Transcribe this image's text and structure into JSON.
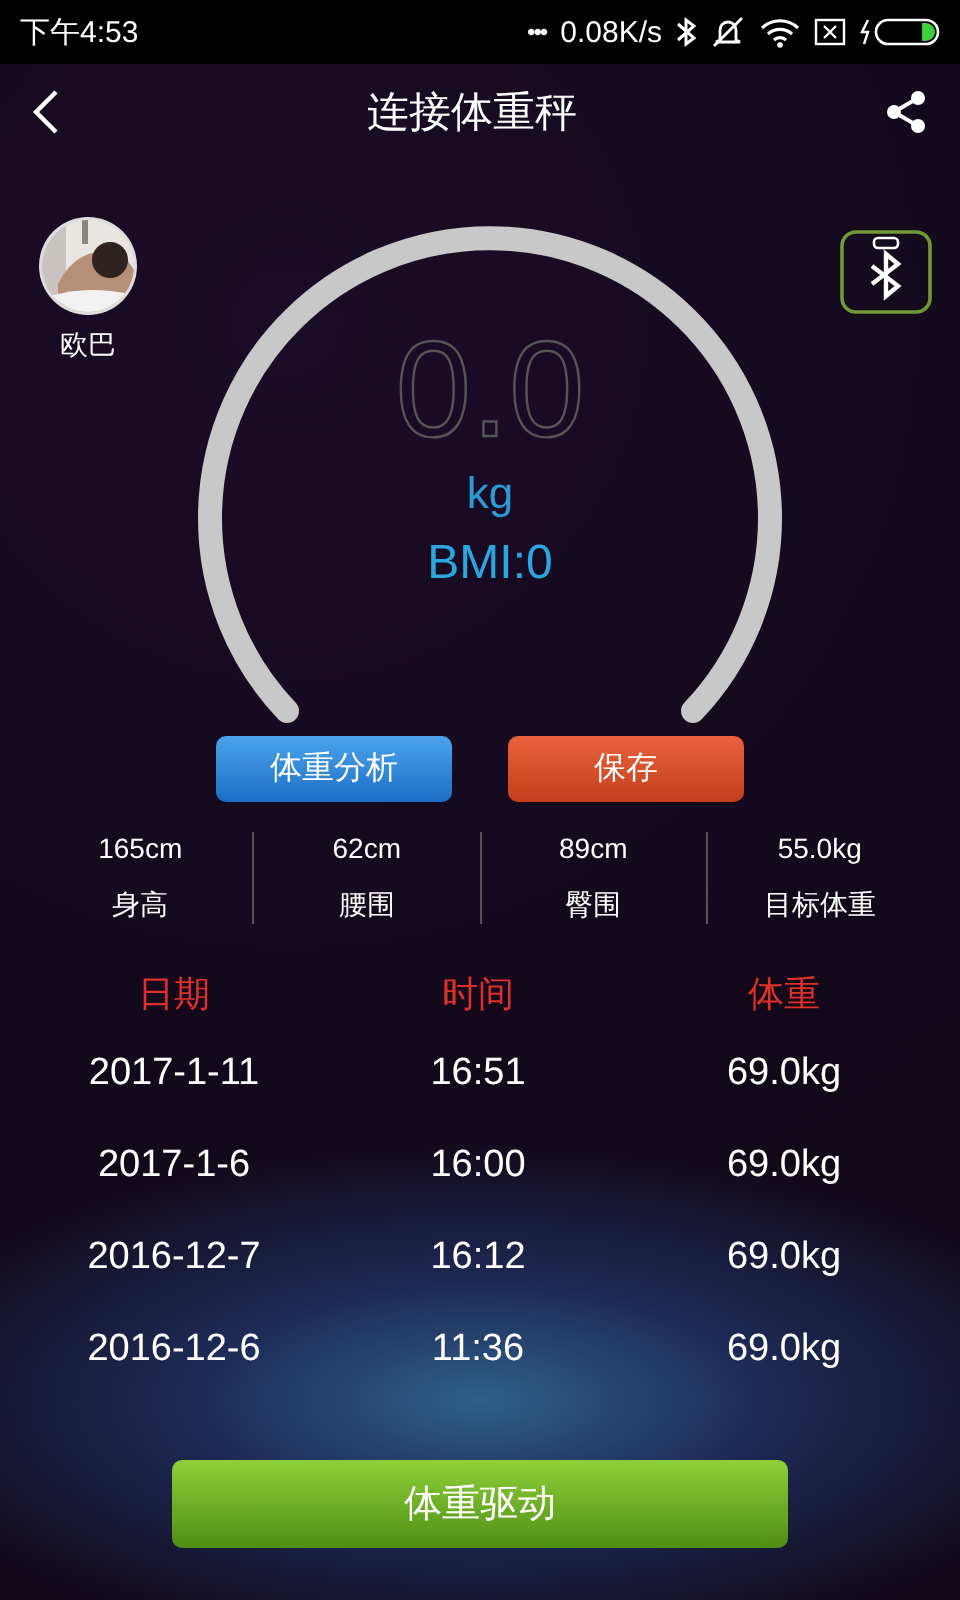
{
  "status_bar": {
    "time": "下午4:53",
    "dots": "•••",
    "network_speed": "0.08K/s"
  },
  "header": {
    "title": "连接体重秤"
  },
  "user": {
    "name": "欧巴"
  },
  "reading": {
    "value": "0.0",
    "unit": "kg",
    "bmi": "BMI:0"
  },
  "actions": [
    {
      "label": "体重分析",
      "kind": "blue"
    },
    {
      "label": "保存",
      "kind": "orange"
    }
  ],
  "stats": [
    {
      "value": "165cm",
      "label": "身高"
    },
    {
      "value": "62cm",
      "label": "腰围"
    },
    {
      "value": "89cm",
      "label": "臀围"
    },
    {
      "value": "55.0kg",
      "label": "目标体重"
    }
  ],
  "table": {
    "columns": [
      "日期",
      "时间",
      "体重"
    ],
    "rows": [
      [
        "2017-1-11",
        "16:51",
        "69.0kg"
      ],
      [
        "2017-1-6",
        "16:00",
        "69.0kg"
      ],
      [
        "2016-12-7",
        "16:12",
        "69.0kg"
      ],
      [
        "2016-12-6",
        "11:36",
        "69.0kg"
      ]
    ]
  },
  "bottom_button": {
    "label": "体重驱动"
  }
}
